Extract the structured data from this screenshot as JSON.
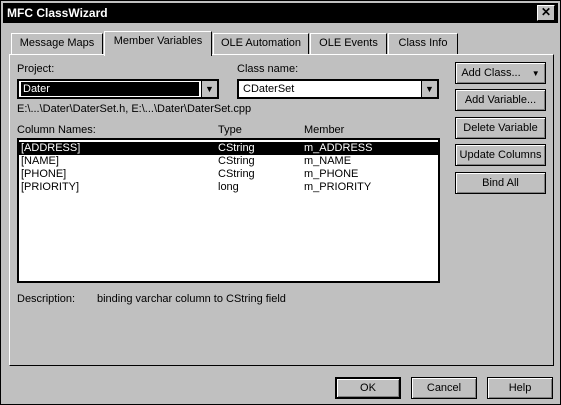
{
  "window": {
    "title": "MFC ClassWizard",
    "close": "✕"
  },
  "tabs": [
    {
      "label": "Message Maps"
    },
    {
      "label": "Member Variables"
    },
    {
      "label": "OLE Automation"
    },
    {
      "label": "OLE Events"
    },
    {
      "label": "Class Info"
    }
  ],
  "project": {
    "label": "Project:",
    "value": "Dater"
  },
  "classname": {
    "label": "Class name:",
    "value": "CDaterSet"
  },
  "files": "E:\\...\\Dater\\DaterSet.h, E:\\...\\Dater\\DaterSet.cpp",
  "columns": {
    "name": "Column Names:",
    "type": "Type",
    "member": "Member"
  },
  "rows": [
    {
      "name": "[ADDRESS]",
      "type": "CString",
      "member": "m_ADDRESS"
    },
    {
      "name": "[NAME]",
      "type": "CString",
      "member": "m_NAME"
    },
    {
      "name": "[PHONE]",
      "type": "CString",
      "member": "m_PHONE"
    },
    {
      "name": "[PRIORITY]",
      "type": "long",
      "member": "m_PRIORITY"
    }
  ],
  "description": {
    "label": "Description:",
    "text": "binding varchar column to CString field"
  },
  "buttons": {
    "add_class": "Add Class...",
    "add_variable": "Add Variable...",
    "delete_variable": "Delete Variable",
    "update_columns": "Update Columns",
    "bind_all": "Bind All"
  },
  "footer": {
    "ok": "OK",
    "cancel": "Cancel",
    "help": "Help"
  }
}
